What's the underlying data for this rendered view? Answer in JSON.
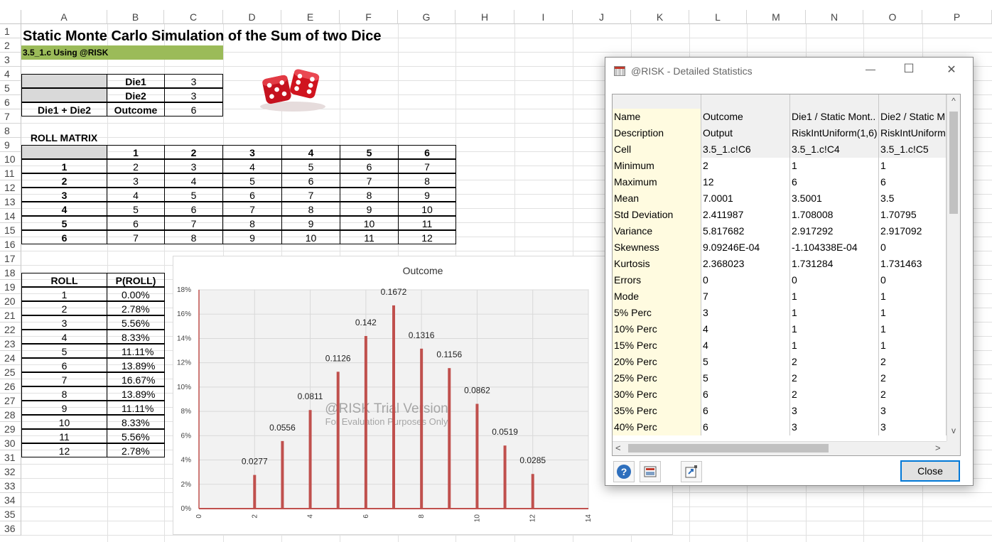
{
  "columns": [
    "A",
    "B",
    "C",
    "D",
    "E",
    "F",
    "G",
    "H",
    "I",
    "J",
    "K",
    "L",
    "M",
    "N",
    "O",
    "P"
  ],
  "rows": [
    "1",
    "2",
    "3",
    "4",
    "5",
    "6",
    "7",
    "8",
    "9",
    "10",
    "11",
    "12",
    "13",
    "14",
    "15",
    "16",
    "17",
    "18",
    "19",
    "20",
    "21",
    "22",
    "23",
    "24",
    "25",
    "26",
    "27",
    "28",
    "29",
    "30",
    "31",
    "32",
    "33",
    "34",
    "35",
    "36"
  ],
  "sheet": {
    "title": "Static Monte Carlo Simulation of the Sum of two Dice",
    "subtitle": "3.5_1.c Using @RISK",
    "die1_label": "Die1",
    "die1_value": "3",
    "die2_label": "Die2",
    "die2_value": "3",
    "sum_label": "Die1 + Die2",
    "outcome_label": "Outcome",
    "outcome_value": "6",
    "roll_matrix_label": "ROLL MATRIX",
    "matrix_headers": [
      "1",
      "2",
      "3",
      "4",
      "5",
      "6"
    ],
    "matrix_rows": [
      {
        "label": "1",
        "cells": [
          "2",
          "3",
          "4",
          "5",
          "6",
          "7"
        ]
      },
      {
        "label": "2",
        "cells": [
          "3",
          "4",
          "5",
          "6",
          "7",
          "8"
        ]
      },
      {
        "label": "3",
        "cells": [
          "4",
          "5",
          "6",
          "7",
          "8",
          "9"
        ]
      },
      {
        "label": "4",
        "cells": [
          "5",
          "6",
          "7",
          "8",
          "9",
          "10"
        ]
      },
      {
        "label": "5",
        "cells": [
          "6",
          "7",
          "8",
          "9",
          "10",
          "11"
        ]
      },
      {
        "label": "6",
        "cells": [
          "7",
          "8",
          "9",
          "10",
          "11",
          "12"
        ]
      }
    ],
    "roll_header": "ROLL",
    "prob_header": "P(ROLL)",
    "roll_table": [
      {
        "roll": "1",
        "p": "0.00%"
      },
      {
        "roll": "2",
        "p": "2.78%"
      },
      {
        "roll": "3",
        "p": "5.56%"
      },
      {
        "roll": "4",
        "p": "8.33%"
      },
      {
        "roll": "5",
        "p": "11.11%"
      },
      {
        "roll": "6",
        "p": "13.89%"
      },
      {
        "roll": "7",
        "p": "16.67%"
      },
      {
        "roll": "8",
        "p": "13.89%"
      },
      {
        "roll": "9",
        "p": "11.11%"
      },
      {
        "roll": "10",
        "p": "8.33%"
      },
      {
        "roll": "11",
        "p": "5.56%"
      },
      {
        "roll": "12",
        "p": "2.78%"
      }
    ]
  },
  "chart_data": {
    "type": "bar",
    "title": "Outcome",
    "x": [
      2,
      3,
      4,
      5,
      6,
      7,
      8,
      9,
      10,
      11,
      12
    ],
    "values": [
      0.0277,
      0.0556,
      0.0811,
      0.1126,
      0.142,
      0.1672,
      0.1316,
      0.1156,
      0.0862,
      0.0519,
      0.0285
    ],
    "data_labels": [
      "0.0277",
      "0.0556",
      "0.0811",
      "0.1126",
      "0.142",
      "0.1672",
      "0.1316",
      "0.1156",
      "0.0862",
      "0.0519",
      "0.0285"
    ],
    "xlim": [
      0,
      14
    ],
    "xticks": [
      "0",
      "2",
      "4",
      "6",
      "8",
      "10",
      "12",
      "14"
    ],
    "ylim": [
      0,
      0.18
    ],
    "yticks": [
      "0%",
      "2%",
      "4%",
      "6%",
      "8%",
      "10%",
      "12%",
      "14%",
      "16%",
      "18%"
    ],
    "grid": true,
    "bar_color": "#c0504d",
    "watermark_line1": "@RISK Trial Version",
    "watermark_line2": "For Evaluation Purposes Only"
  },
  "dialog": {
    "title": "@RISK - Detailed Statistics",
    "close_label": "Close",
    "minimize_glyph": "—",
    "maximize_glyph": "☐",
    "close_glyph": "✕",
    "help_glyph": "?",
    "scroll_left": "<",
    "scroll_right": ">",
    "scroll_up": "^",
    "scroll_down": "v",
    "stats": [
      [
        "Name",
        "Outcome",
        "Die1 / Static Mont..",
        "Die2 / Static M"
      ],
      [
        "Description",
        "Output",
        "RiskIntUniform(1,6)",
        "RiskIntUniform"
      ],
      [
        "Cell",
        "3.5_1.c!C6",
        "3.5_1.c!C4",
        "3.5_1.c!C5"
      ],
      [
        "Minimum",
        "2",
        "1",
        "1"
      ],
      [
        "Maximum",
        "12",
        "6",
        "6"
      ],
      [
        "Mean",
        "7.0001",
        "3.5001",
        "3.5"
      ],
      [
        "Std Deviation",
        "2.411987",
        "1.708008",
        "1.70795"
      ],
      [
        "Variance",
        "5.817682",
        "2.917292",
        "2.917092"
      ],
      [
        "Skewness",
        "9.09246E-04",
        "-1.104338E-04",
        "0"
      ],
      [
        "Kurtosis",
        "2.368023",
        "1.731284",
        "1.731463"
      ],
      [
        "Errors",
        "0",
        "0",
        "0"
      ],
      [
        "Mode",
        "7",
        "1",
        "1"
      ],
      [
        "5% Perc",
        "3",
        "1",
        "1"
      ],
      [
        "10% Perc",
        "4",
        "1",
        "1"
      ],
      [
        "15% Perc",
        "4",
        "1",
        "1"
      ],
      [
        "20% Perc",
        "5",
        "2",
        "2"
      ],
      [
        "25% Perc",
        "5",
        "2",
        "2"
      ],
      [
        "30% Perc",
        "6",
        "2",
        "2"
      ],
      [
        "35% Perc",
        "6",
        "3",
        "3"
      ],
      [
        "40% Perc",
        "6",
        "3",
        "3"
      ]
    ]
  }
}
